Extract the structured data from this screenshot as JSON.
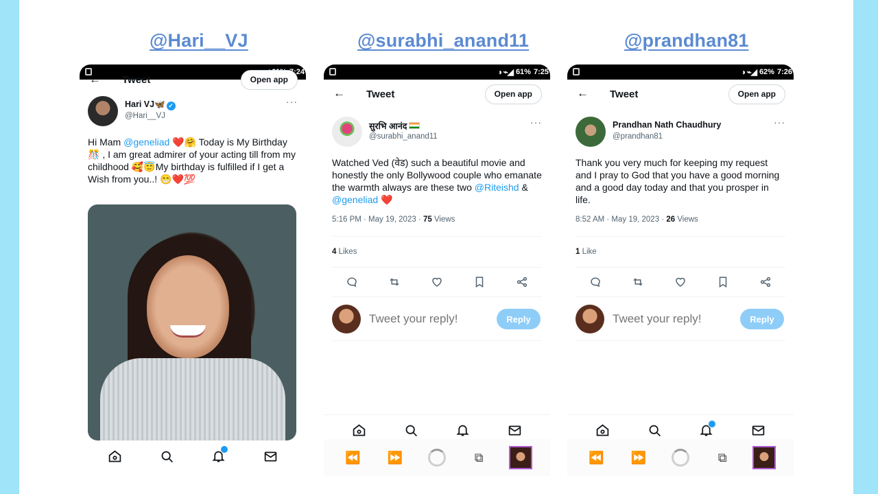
{
  "panels": [
    {
      "handle": "@Hari__VJ",
      "status_bar": {
        "icons": "◑ ⌁◢",
        "battery": "61%",
        "time": "7:24"
      },
      "header": {
        "title": "Tweet",
        "open_app": "Open app"
      },
      "author": {
        "name": "Hari VJ🦋",
        "handle": "@Hari__VJ"
      },
      "tweet_text_parts": {
        "a": "Hi Mam ",
        "mention": "@geneliad",
        "b": " ❤️🤗 Today is My Birthday 🎊 , I am great admirer of your acting till from my childhood 🥰😇My birthday is fulfilled if I get a Wish from you..! 😁❤️💯"
      },
      "nav": [
        "home-icon",
        "search-icon",
        "notifications-icon",
        "messages-icon"
      ]
    },
    {
      "handle": "@surabhi_anand11",
      "status_bar": {
        "icons": "◑ ⌁◢",
        "battery": "61%",
        "time": "7:25"
      },
      "header": {
        "title": "Tweet",
        "open_app": "Open app"
      },
      "author": {
        "name": "सुरभि आनंद",
        "handle": "@surabhi_anand11"
      },
      "tweet_text_parts": {
        "a": "Watched Ved (वेड) such a beautiful movie and honestly the only Bollywood couple who emanate the warmth always are these two ",
        "mention1": "@Riteishd",
        "amp": " & ",
        "mention2": "@geneliad",
        "b": " ❤️"
      },
      "meta": {
        "time": "5:16 PM · May 19, 2023 · ",
        "views_count": "75",
        "views_label": " Views"
      },
      "likes": {
        "count": "4",
        "label": " Likes"
      },
      "reply": {
        "placeholder": "Tweet your reply!",
        "button": "Reply"
      }
    },
    {
      "handle": "@prandhan81",
      "status_bar": {
        "icons": "◑ ⌁◢",
        "battery": "62%",
        "time": "7:26"
      },
      "header": {
        "title": "Tweet",
        "open_app": "Open app"
      },
      "author": {
        "name": "Prandhan Nath Chaudhury",
        "handle": "@prandhan81"
      },
      "tweet_text": "Thank you very much for keeping my request and I pray to God that you have a good morning and a good day today and that you prosper in life.",
      "meta": {
        "time": "8:52 AM · May 19, 2023 · ",
        "views_count": "26",
        "views_label": " Views"
      },
      "likes": {
        "count": "1",
        "label": " Like"
      },
      "reply": {
        "placeholder": "Tweet your reply!",
        "button": "Reply"
      }
    }
  ],
  "colors": {
    "side_bar": "#9fe4f8",
    "handle_link": "#5b8ad1",
    "twitter_blue": "#1d9bf0",
    "reply_button": "#8ecdf8"
  }
}
